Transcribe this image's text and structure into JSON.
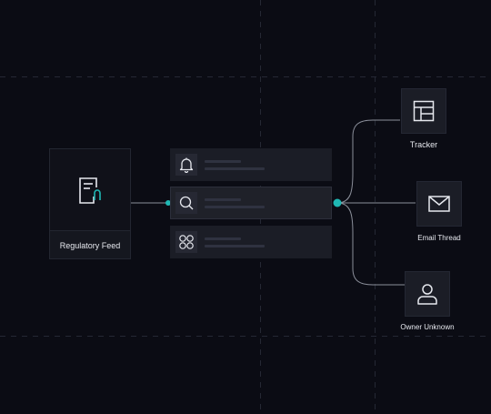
{
  "source": {
    "label": "Regulatory Feed",
    "icon": "document-clip-icon",
    "accent": "#1fb8b4"
  },
  "rows": [
    {
      "icon": "bell-icon",
      "active": false
    },
    {
      "icon": "search-icon",
      "active": true
    },
    {
      "icon": "grid-circles-icon",
      "active": false
    }
  ],
  "targets": [
    {
      "label": "Tracker",
      "icon": "table-icon"
    },
    {
      "label": "Email Thread",
      "icon": "envelope-icon"
    },
    {
      "label": "Owner Unknown",
      "icon": "user-icon"
    }
  ],
  "colors": {
    "background": "#0b0c14",
    "connector": "#8b8f9a",
    "node": "#1fb8b4",
    "grid": "#2a2d3a"
  }
}
